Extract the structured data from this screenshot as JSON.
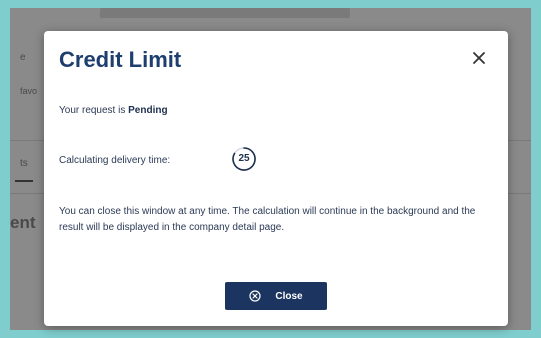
{
  "background": {
    "left_fragment_1": "e",
    "left_fragment_2": "favo",
    "left_fragment_3": "ts",
    "left_fragment_4": "ent"
  },
  "modal": {
    "title": "Credit Limit",
    "close_icon": "close-x-icon",
    "status_prefix": "Your request is ",
    "status_value": "Pending",
    "calculating_label": "Calculating delivery time:",
    "countdown_value": "25",
    "info_text": "You can close this window at any time. The calculation will continue in the background and the result will be displayed in the company detail page.",
    "close_button_label": "Close",
    "close_button_icon": "circle-x-icon"
  },
  "colors": {
    "frame": "#7fcdcd",
    "title": "#1d3e6e",
    "button": "#1b3560",
    "overlay": "#8a8a8a"
  }
}
